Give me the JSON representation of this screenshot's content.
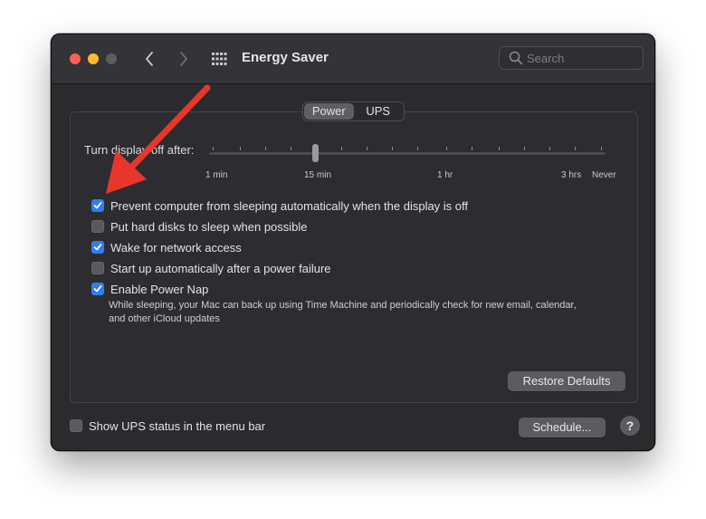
{
  "window": {
    "title": "Energy Saver",
    "search_placeholder": "Search"
  },
  "tabs": [
    {
      "label": "Power",
      "active": true
    },
    {
      "label": "UPS",
      "active": false
    }
  ],
  "slider": {
    "label": "Turn display off after:",
    "scale_labels": [
      "1 min",
      "15 min",
      "1 hr",
      "3 hrs",
      "Never"
    ],
    "value": "15 min"
  },
  "options": [
    {
      "label": "Prevent computer from sleeping automatically when the display is off",
      "checked": true
    },
    {
      "label": "Put hard disks to sleep when possible",
      "checked": false
    },
    {
      "label": "Wake for network access",
      "checked": true
    },
    {
      "label": "Start up automatically after a power failure",
      "checked": false
    },
    {
      "label": "Enable Power Nap",
      "checked": true
    }
  ],
  "power_nap_description": "While sleeping, your Mac can back up using Time Machine and periodically check for new email, calendar, and other iCloud updates",
  "buttons": {
    "restore_defaults": "Restore Defaults",
    "schedule": "Schedule...",
    "help": "?"
  },
  "ups_menu_bar": {
    "label": "Show UPS status in the menu bar",
    "checked": false
  },
  "colors": {
    "accent": "#2f7cf6",
    "annotation_arrow": "#e8362c",
    "traffic_close": "#fe5f57",
    "traffic_minimize": "#febc2e"
  }
}
